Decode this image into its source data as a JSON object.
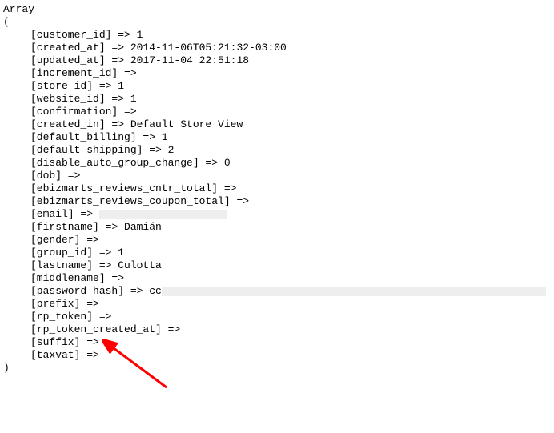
{
  "header": "Array",
  "open": "(",
  "close": ")",
  "entries": [
    {
      "key": "customer_id",
      "value": "1"
    },
    {
      "key": "created_at",
      "value": "2014-11-06T05:21:32-03:00"
    },
    {
      "key": "updated_at",
      "value": "2017-11-04 22:51:18"
    },
    {
      "key": "increment_id",
      "value": ""
    },
    {
      "key": "store_id",
      "value": "1"
    },
    {
      "key": "website_id",
      "value": "1"
    },
    {
      "key": "confirmation",
      "value": ""
    },
    {
      "key": "created_in",
      "value": "Default Store View"
    },
    {
      "key": "default_billing",
      "value": "1"
    },
    {
      "key": "default_shipping",
      "value": "2"
    },
    {
      "key": "disable_auto_group_change",
      "value": "0"
    },
    {
      "key": "dob",
      "value": ""
    },
    {
      "key": "ebizmarts_reviews_cntr_total",
      "value": ""
    },
    {
      "key": "ebizmarts_reviews_coupon_total",
      "value": ""
    },
    {
      "key": "email",
      "value": "",
      "redacted": 1
    },
    {
      "key": "firstname",
      "value": "Damián"
    },
    {
      "key": "gender",
      "value": ""
    },
    {
      "key": "group_id",
      "value": "1"
    },
    {
      "key": "lastname",
      "value": "Culotta"
    },
    {
      "key": "middlename",
      "value": ""
    },
    {
      "key": "password_hash",
      "value": "cc",
      "redacted": 2
    },
    {
      "key": "prefix",
      "value": ""
    },
    {
      "key": "rp_token",
      "value": ""
    },
    {
      "key": "rp_token_created_at",
      "value": ""
    },
    {
      "key": "suffix",
      "value": ""
    },
    {
      "key": "taxvat",
      "value": ""
    }
  ]
}
